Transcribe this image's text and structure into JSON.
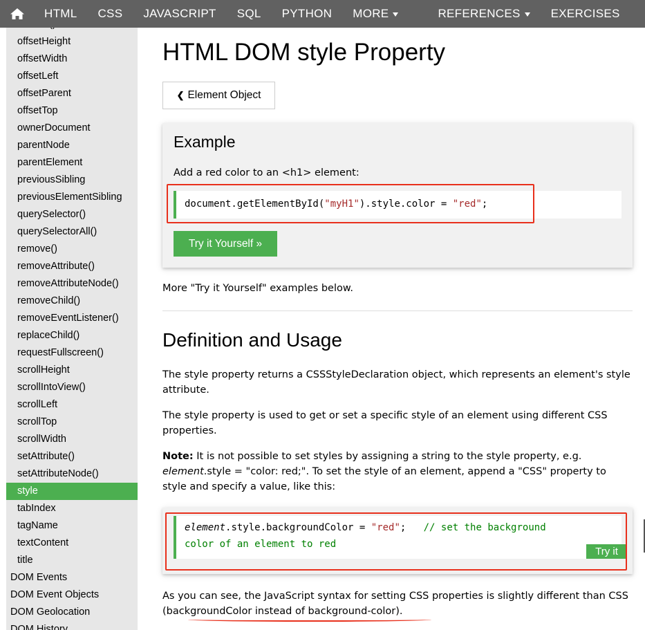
{
  "nav": {
    "items": [
      {
        "label": "HTML"
      },
      {
        "label": "CSS"
      },
      {
        "label": "JAVASCRIPT"
      },
      {
        "label": "SQL"
      },
      {
        "label": "PYTHON"
      },
      {
        "label": "MORE"
      }
    ],
    "right_items": [
      {
        "label": "REFERENCES"
      },
      {
        "label": "EXERCISES"
      }
    ],
    "home_icon": "home-icon",
    "bg": "#616161"
  },
  "sidebar": {
    "top_partial": "()",
    "items": [
      "offsetHeight",
      "offsetWidth",
      "offsetLeft",
      "offsetParent",
      "offsetTop",
      "ownerDocument",
      "parentNode",
      "parentElement",
      "previousSibling",
      "previousElementSibling",
      "querySelector()",
      "querySelectorAll()",
      "remove()",
      "removeAttribute()",
      "removeAttributeNode()",
      "removeChild()",
      "removeEventListener()",
      "replaceChild()",
      "requestFullscreen()",
      "scrollHeight",
      "scrollIntoView()",
      "scrollLeft",
      "scrollTop",
      "scrollWidth",
      "setAttribute()",
      "setAttributeNode()",
      "style",
      "tabIndex",
      "tagName",
      "textContent",
      "title"
    ],
    "active": "style",
    "sections": [
      "DOM Events",
      "DOM Event Objects",
      "DOM Geolocation",
      "DOM History"
    ],
    "accent": "#4caf50"
  },
  "main": {
    "title": "HTML DOM style Property",
    "back_label": "Element Object",
    "example": {
      "heading": "Example",
      "desc": "Add a red color to an <h1> element:",
      "code_pre": "document.getElementById(",
      "code_str1": "\"myH1\"",
      "code_mid": ").style.color = ",
      "code_str2": "\"red\"",
      "code_post": ";",
      "try_label": "Try it Yourself »"
    },
    "more": "More \"Try it Yourself\" examples below.",
    "definition_heading": "Definition and Usage",
    "p1": "The style property returns a CSSStyleDeclaration object, which represents an element's style attribute.",
    "p2": "The style property is used to get or set a specific style of an element using different CSS properties.",
    "p3_bold": "Note:",
    "p3_a": " It is not possible to set styles by assigning a string to the style property, e.g. ",
    "p3_em": "element",
    "p3_b": ".style = \"color: red;\". To set the style of an element, append a \"CSS\" property to style and specify a value, like this:",
    "code2": {
      "em": "element",
      "mid": ".style.backgroundColor = ",
      "str": "\"red\"",
      "semi": ";",
      "comment1": "// set the background",
      "comment2": "color of an element to red",
      "try_label": "Try it"
    },
    "p4_a": "As you can see, the JavaScript syntax for setting CSS properties is slightly different than CSS (",
    "p4_b": "backgroundColor instead of background-color",
    "p4_c": ")."
  }
}
